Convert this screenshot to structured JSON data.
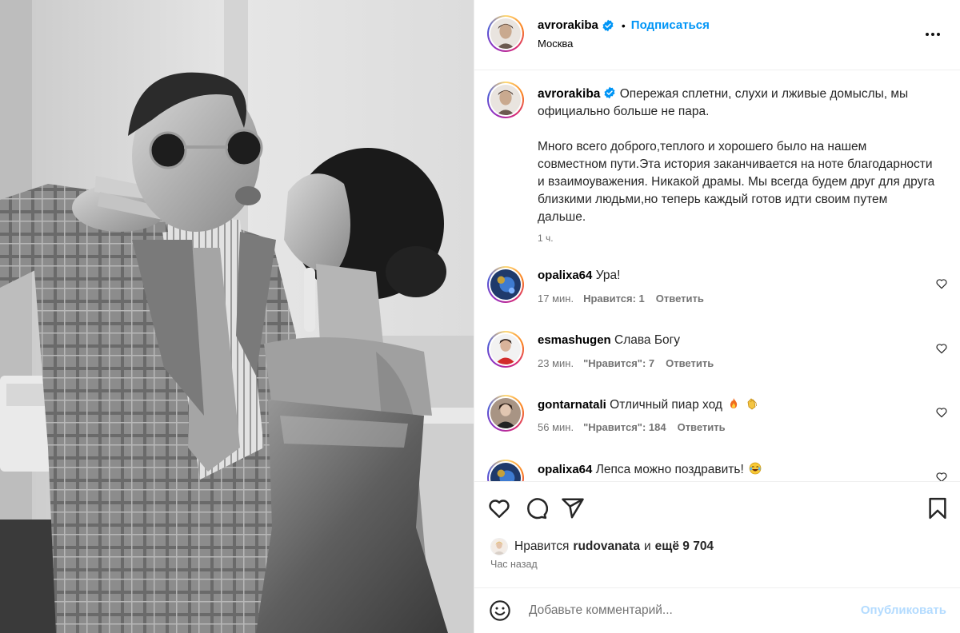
{
  "post": {
    "author": "avrorakiba",
    "verified_icon": "verified-badge-icon",
    "follow_label": "Подписаться",
    "separator": "•",
    "location": "Москва",
    "more_icon": "more-options-icon"
  },
  "caption": {
    "author": "avrorakiba",
    "text_1": "Опережая сплетни, слухи и лживые домыслы, мы официально больше не пара.",
    "text_2": "Много всего доброго,теплого и хорошего было на нашем совместном пути.Эта история заканчивается на ноте благодарности и взаимоуважения. Никакой драмы. Мы всегда будем друг для друга близкими людьми,но теперь каждый готов идти своим путем дальше.",
    "time": "1 ч."
  },
  "comments": [
    {
      "user": "opalixa64",
      "text": "Ура!",
      "time": "17 мин.",
      "likes": "Нравится: 1",
      "reply": "Ответить"
    },
    {
      "user": "esmashugen",
      "text": "Слава Богу",
      "time": "23 мин.",
      "likes": "\"Нравится\": 7",
      "reply": "Ответить"
    },
    {
      "user": "gontarnatali",
      "text": "Отличный пиар ход",
      "time": "56 мин.",
      "likes": "\"Нравится\": 184",
      "reply": "Ответить"
    },
    {
      "user": "opalixa64",
      "text": "Лепса можно поздравить!",
      "time": "",
      "likes": "",
      "reply": ""
    }
  ],
  "actions": {
    "like_icon": "heart-icon",
    "comment_icon": "comment-icon",
    "share_icon": "share-icon",
    "save_icon": "bookmark-icon"
  },
  "likes": {
    "prefix": "Нравится",
    "user": "rudovanata",
    "and": "и",
    "others": "ещё 9 704"
  },
  "posted_ago": "Час назад",
  "composer": {
    "placeholder": "Добавьте комментарий...",
    "publish_label": "Опубликовать"
  },
  "colors": {
    "accent": "#0095f6",
    "publish_disabled": "#b3dbff",
    "secondary_text": "#737373",
    "border": "#efefef"
  }
}
